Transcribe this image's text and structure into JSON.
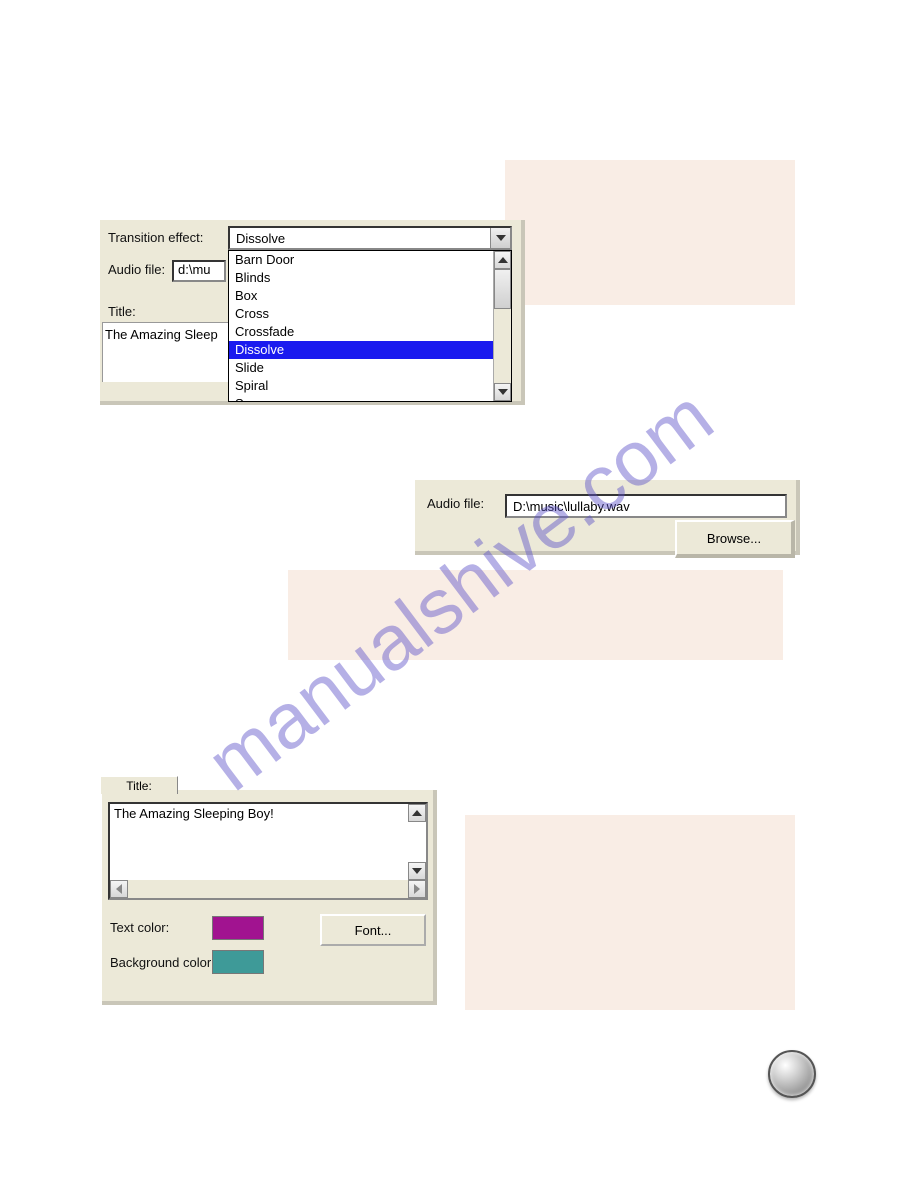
{
  "panel1": {
    "transition_label": "Transition effect:",
    "audio_label": "Audio file:",
    "title_label": "Title:",
    "combo_value": "Dissolve",
    "audio_value": "d:\\mu",
    "title_text": "The Amazing Sleep",
    "options": [
      "Barn Door",
      "Blinds",
      "Box",
      "Cross",
      "Crossfade",
      "Dissolve",
      "Slide",
      "Spiral",
      "Sweep"
    ],
    "selected_index": 5
  },
  "panel2": {
    "audio_label": "Audio file:",
    "audio_value": "D:\\music\\lullaby.wav",
    "browse_label": "Browse..."
  },
  "panel3": {
    "tab_label": "Title:",
    "text_value": "The Amazing Sleeping Boy!",
    "text_color_label": "Text color:",
    "bg_color_label": "Background color:",
    "text_color": "#a11390",
    "bg_color": "#3e9a98",
    "font_label": "Font..."
  },
  "watermark": "manualshive.com"
}
